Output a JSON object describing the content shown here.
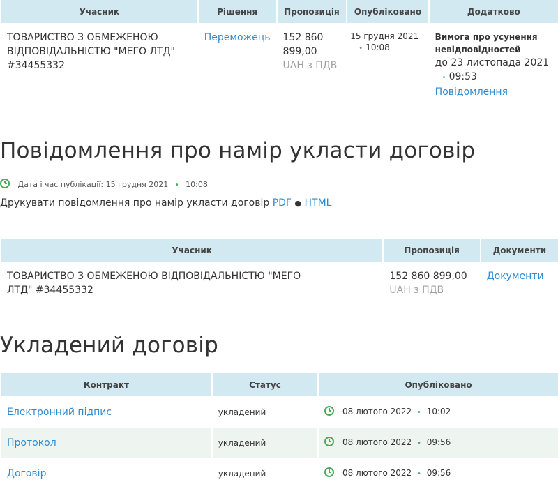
{
  "table1": {
    "headers": [
      "Учасник",
      "Рішення",
      "Пропозиція",
      "Опубліковано",
      "Додатково"
    ],
    "row": {
      "participant": "ТОВАРИСТВО З ОБМЕЖЕНОЮ ВІДПОВІДАЛЬНІСТЮ \"МЕГО ЛТД\" #34455332",
      "decision": "Переможець",
      "offer_amount": "152 860 899,00",
      "offer_vat": "UAH з ПДВ",
      "published_date": "15 грудня 2021",
      "published_time": "10:08",
      "extra_title": "Вимога про усунення невідповідностей",
      "extra_deadline": "до 23 листопада 2021",
      "extra_time": "09:53",
      "extra_link": "Повідомлення"
    }
  },
  "intent": {
    "title": "Повідомлення про намір укласти договір",
    "pub_label": "Дата і час публікації: 15 грудня 2021",
    "pub_time": "10:08",
    "print_text": "Друкувати повідомлення про намір укласти договір",
    "pdf": "PDF",
    "bullet": "●",
    "html": "HTML"
  },
  "table2": {
    "headers": [
      "Учасник",
      "Пропозиція",
      "Документи"
    ],
    "row": {
      "participant": "ТОВАРИСТВО З ОБМЕЖЕНОЮ ВІДПОВІДАЛЬНІСТЮ \"МЕГО ЛТД\" #34455332",
      "offer_amount": "152 860 899,00",
      "offer_vat": "UAH з ПДВ",
      "docs_link": "Документи"
    }
  },
  "contract": {
    "title": "Укладений договір",
    "headers": [
      "Контракт",
      "Статус",
      "Опубліковано"
    ],
    "rows": [
      {
        "name": "Електронний підпис",
        "status": "укладений",
        "date": "08 лютого 2022",
        "time": "10:02"
      },
      {
        "name": "Протокол",
        "status": "укладений",
        "date": "08 лютого 2022",
        "time": "09:56"
      },
      {
        "name": "Договір",
        "status": "укладений",
        "date": "08 лютого 2022",
        "time": "09:56"
      }
    ]
  },
  "colors": {
    "header_bg": "#d3e9f1",
    "link": "#2f8bd0",
    "accent": "#4aaa5a",
    "stripe": "#eef5f0"
  },
  "icons": [
    "clock-icon",
    "dot-separator"
  ]
}
